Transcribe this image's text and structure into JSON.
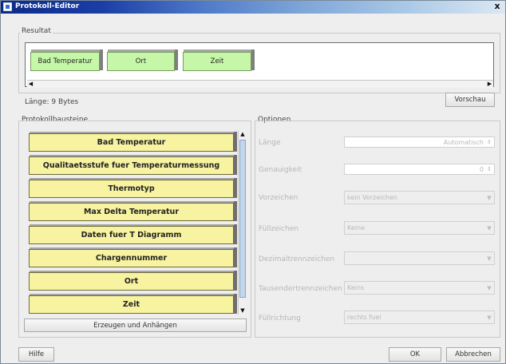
{
  "window": {
    "title": "Protokoll-Editor",
    "close_glyph": "x"
  },
  "resultat": {
    "label": "Resultat",
    "chips": [
      "Bad Temperatur",
      "Ort",
      "Zeit"
    ]
  },
  "laenge_label": "Länge: 9 Bytes",
  "buttons": {
    "vorschau": "Vorschau",
    "erzeugen": "Erzeugen und Anhängen",
    "hilfe": "Hilfe",
    "ok": "OK",
    "abbrechen": "Abbrechen"
  },
  "protokollbausteine": {
    "label": "Protokollbausteine",
    "items": [
      "Bad Temperatur",
      "Qualitaetsstufe fuer Temperaturmessung",
      "Thermotyp",
      "Max Delta Temperatur",
      "Daten fuer T Diagramm",
      "Chargennummer",
      "Ort",
      "Zeit"
    ]
  },
  "optionen": {
    "label": "Optionen",
    "rows": [
      {
        "label": "Länge",
        "value": "Automatisch"
      },
      {
        "label": "Genauigkeit",
        "value": "0"
      },
      {
        "label": "Vorzeichen",
        "value": "kein Vorzeichen"
      },
      {
        "label": "Füllzeichen",
        "value": "Keine"
      },
      {
        "label": "Dezimaltrennzeichen",
        "value": ""
      },
      {
        "label": "Tausendertrennzeichen",
        "value": "Keins"
      },
      {
        "label": "Füllrichtung",
        "value": "rechts fuel"
      }
    ]
  },
  "colors": {
    "chip_green": "#c6f7a8",
    "item_yellow": "#f7f3a0",
    "title_blue": "#0b2a8a"
  }
}
